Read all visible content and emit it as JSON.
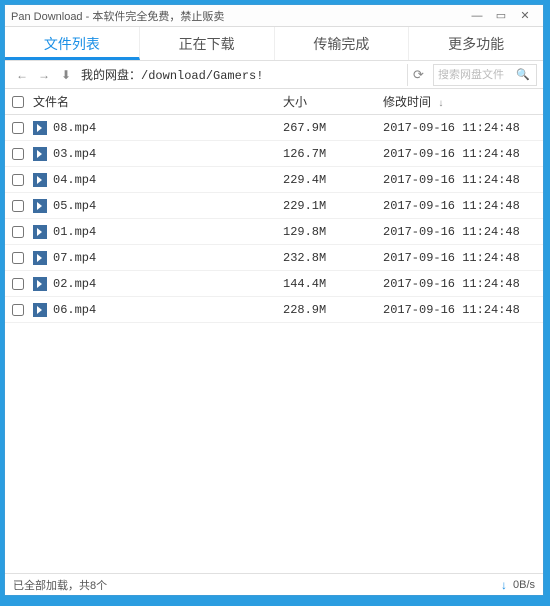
{
  "window": {
    "title": "Pan Download - 本软件完全免费，禁止贩卖"
  },
  "tabs": [
    {
      "label": "文件列表",
      "active": true
    },
    {
      "label": "正在下载",
      "active": false
    },
    {
      "label": "传输完成",
      "active": false
    },
    {
      "label": "更多功能",
      "active": false
    }
  ],
  "path": {
    "prefix": "我的网盘：",
    "value": "/download/Gamers!"
  },
  "search": {
    "placeholder": "搜索网盘文件"
  },
  "columns": {
    "name": "文件名",
    "size": "大小",
    "mtime": "修改时间"
  },
  "sort_indicator": "↓",
  "files": [
    {
      "name": "08.mp4",
      "size": "267.9M",
      "mtime": "2017-09-16 11:24:48"
    },
    {
      "name": "03.mp4",
      "size": "126.7M",
      "mtime": "2017-09-16 11:24:48"
    },
    {
      "name": "04.mp4",
      "size": "229.4M",
      "mtime": "2017-09-16 11:24:48"
    },
    {
      "name": "05.mp4",
      "size": "229.1M",
      "mtime": "2017-09-16 11:24:48"
    },
    {
      "name": "01.mp4",
      "size": "129.8M",
      "mtime": "2017-09-16 11:24:48"
    },
    {
      "name": "07.mp4",
      "size": "232.8M",
      "mtime": "2017-09-16 11:24:48"
    },
    {
      "name": "02.mp4",
      "size": "144.4M",
      "mtime": "2017-09-16 11:24:48"
    },
    {
      "name": "06.mp4",
      "size": "228.9M",
      "mtime": "2017-09-16 11:24:48"
    }
  ],
  "status": {
    "loaded": "已全部加载，共8个",
    "speed": "0B/s"
  }
}
